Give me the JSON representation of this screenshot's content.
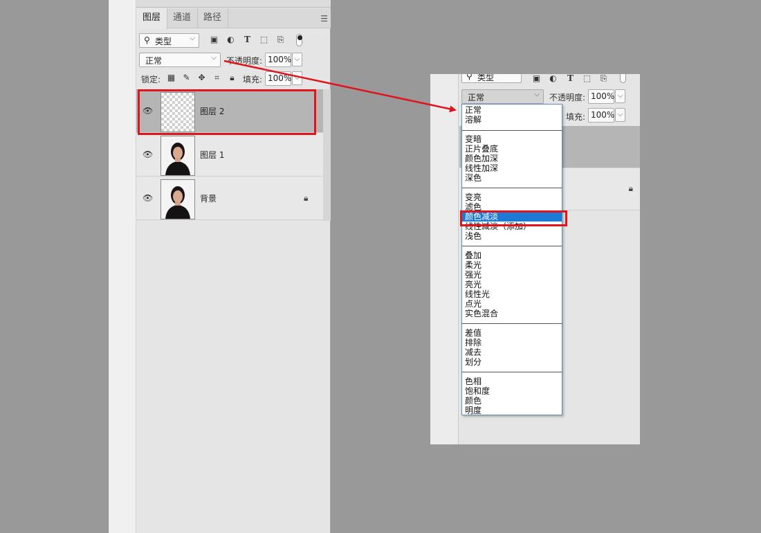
{
  "panel": {
    "tabs": [
      "图层",
      "通道",
      "路径"
    ],
    "filter_kind": "类型",
    "blend_mode": "正常",
    "opacity_label": "不透明度:",
    "opacity_value": "100%",
    "lock_label": "锁定:",
    "fill_label": "填充:",
    "fill_value": "100%",
    "layers": [
      {
        "name": "图层 2",
        "selected": true
      },
      {
        "name": "图层 1",
        "selected": false
      },
      {
        "name": "背景",
        "locked": true
      }
    ]
  },
  "zoom": {
    "filter_kind": "类型",
    "blend_mode": "正常",
    "opacity_label": "不透明度:",
    "opacity_value": "100%",
    "fill_label": "填充:",
    "fill_value": "100%"
  },
  "dropdown": {
    "groups": [
      [
        "正常",
        "溶解"
      ],
      [
        "变暗",
        "正片叠底",
        "颜色加深",
        "线性加深",
        "深色"
      ],
      [
        "变亮",
        "滤色",
        "颜色减淡",
        "线性减淡（添加）",
        "浅色"
      ],
      [
        "叠加",
        "柔光",
        "强光",
        "亮光",
        "线性光",
        "点光",
        "实色混合"
      ],
      [
        "差值",
        "排除",
        "减去",
        "划分"
      ],
      [
        "色相",
        "饱和度",
        "颜色",
        "明度"
      ]
    ],
    "highlighted": "颜色减淡"
  },
  "colors": {
    "highlight": "#1c7ad4",
    "annotation_red": "#e0141b",
    "panel_bg": "#e5e5e5",
    "selected_layer": "#b5b5b5"
  }
}
